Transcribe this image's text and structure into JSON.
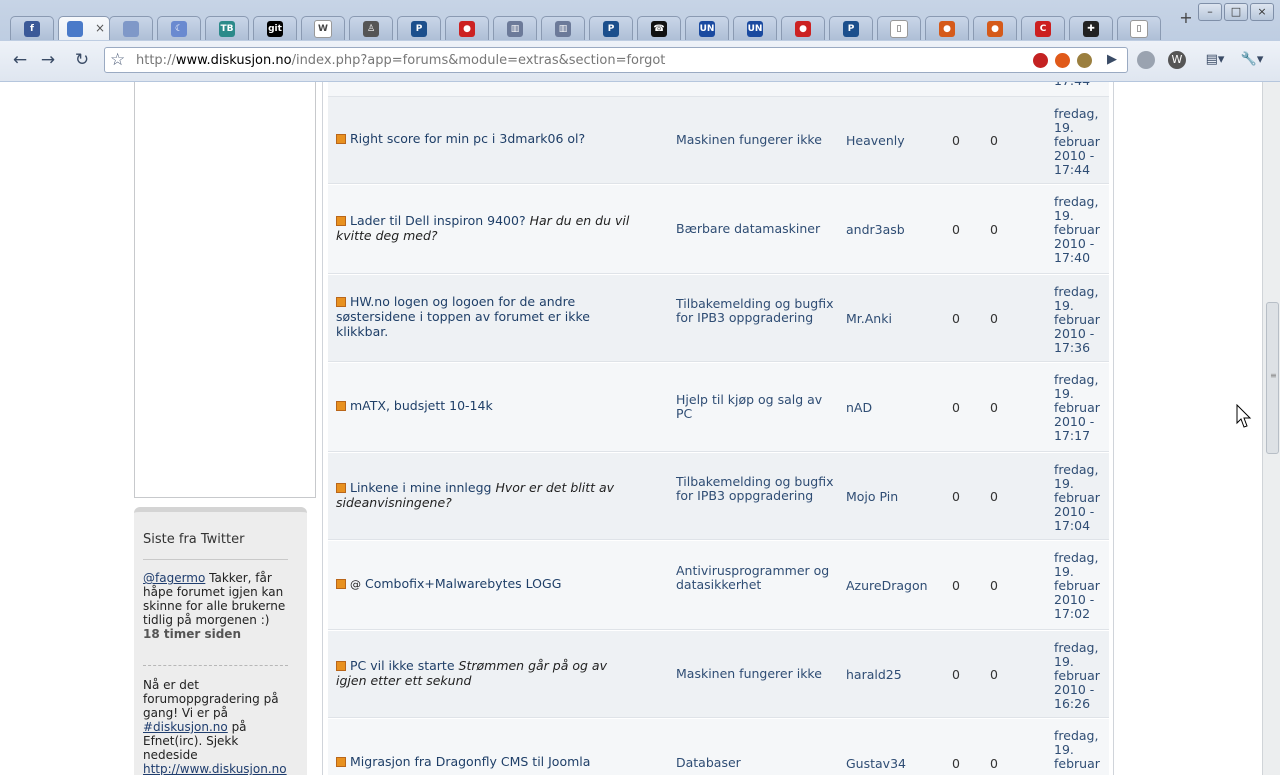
{
  "browser": {
    "tabs": [
      {
        "icon": "f",
        "color": "#3b5998"
      },
      {
        "icon": "",
        "color": "#4a7ac9",
        "active": true
      },
      {
        "icon": "",
        "color": "#7f98c8"
      },
      {
        "icon": "☾",
        "color": "#6a8ad0"
      },
      {
        "icon": "TB",
        "color": "#2c8a8a"
      },
      {
        "icon": "git",
        "color": "#000000"
      },
      {
        "icon": "W",
        "color": "#ffffff"
      },
      {
        "icon": "♙",
        "color": "#555555"
      },
      {
        "icon": "P",
        "color": "#1c4f8c"
      },
      {
        "icon": "●",
        "color": "#cc2222"
      },
      {
        "icon": "▥",
        "color": "#6c7a99"
      },
      {
        "icon": "▥",
        "color": "#6c7a99"
      },
      {
        "icon": "P",
        "color": "#1c4f8c"
      },
      {
        "icon": "☎",
        "color": "#111111"
      },
      {
        "icon": "UN",
        "color": "#1a4aa0"
      },
      {
        "icon": "UN",
        "color": "#1a4aa0"
      },
      {
        "icon": "●",
        "color": "#cc2222"
      },
      {
        "icon": "P",
        "color": "#1c4f8c"
      },
      {
        "icon": "▯",
        "color": "#ffffff"
      },
      {
        "icon": "●",
        "color": "#d55a1a"
      },
      {
        "icon": "●",
        "color": "#d55a1a"
      },
      {
        "icon": "C",
        "color": "#cc1f1f"
      },
      {
        "icon": "✚",
        "color": "#222222"
      },
      {
        "icon": "▯",
        "color": "#ffffff"
      }
    ],
    "tab_close": "×",
    "new_tab": "+",
    "window_controls": {
      "minimize": "–",
      "maximize": "□",
      "close": "×"
    },
    "nav": {
      "back": "←",
      "forward": "→",
      "reload": "↻",
      "star": "☆",
      "go": "▶",
      "page_menu": "▤▾",
      "tools_menu": "🔧▾"
    },
    "url_prefix": "http://",
    "url_host": "www.diskusjon.no",
    "url_path": "/index.php?app=forums&module=extras&section=forgot"
  },
  "sidebar": {
    "twitter_title": "Siste fra Twitter",
    "tweet1_user": "@fagermo",
    "tweet1_text": " Takker, får håpe forumet igjen kan skinne for alle brukerne tidlig på morgenen :)",
    "tweet1_time": "18 timer siden",
    "tweet2_text_a": "Nå er det forumoppgradering på gang! Vi er på ",
    "tweet2_link": "#diskusjon.no",
    "tweet2_text_b": " på Efnet(irc). Sjekk nedeside ",
    "tweet2_url": "http://www.diskusjon.no"
  },
  "table": {
    "partial_top_date": "17:44",
    "rows": [
      {
        "title": "Right score for min pc i 3dmark06 ol?",
        "desc": "",
        "forum": "Maskinen fungerer ikke",
        "author": "Heavenly",
        "replies": "0",
        "views": "0",
        "date": [
          "fredag,",
          "19.",
          "februar",
          "2010 -",
          "17:44"
        ]
      },
      {
        "title": "Lader til Dell inspiron 9400?",
        "desc": "Har du en du vil kvitte deg med?",
        "forum": "Bærbare datamaskiner",
        "author": "andr3asb",
        "replies": "0",
        "views": "0",
        "date": [
          "fredag,",
          "19.",
          "februar",
          "2010 -",
          "17:40"
        ]
      },
      {
        "title": "HW.no logen og logoen for de andre søstersidene i toppen av forumet er ikke klikkbar.",
        "desc": "",
        "forum": "Tilbakemelding og bugfix for IPB3 oppgradering",
        "author": "Mr.Anki",
        "replies": "0",
        "views": "0",
        "date": [
          "fredag,",
          "19.",
          "februar",
          "2010 -",
          "17:36"
        ]
      },
      {
        "title": "mATX, budsjett 10-14k",
        "desc": "",
        "forum": "Hjelp til kjøp og salg av PC",
        "author": "nAD",
        "replies": "0",
        "views": "0",
        "date": [
          "fredag,",
          "19.",
          "februar",
          "2010 -",
          "17:17"
        ]
      },
      {
        "title": "Linkene i mine innlegg",
        "desc": "Hvor er det blitt av sideanvisningene?",
        "forum": "Tilbakemelding og bugfix for IPB3 oppgradering",
        "author": "Mojo Pin",
        "replies": "0",
        "views": "0",
        "date": [
          "fredag,",
          "19.",
          "februar",
          "2010 -",
          "17:04"
        ]
      },
      {
        "title": "Combofix+Malwarebytes LOGG",
        "desc": "",
        "attachment": "@",
        "forum": "Antivirusprogrammer og datasikkerhet",
        "author": "AzureDragon",
        "replies": "0",
        "views": "0",
        "date": [
          "fredag,",
          "19.",
          "februar",
          "2010 -",
          "17:02"
        ]
      },
      {
        "title": "PC vil ikke starte",
        "desc": "Strømmen går på og av igjen etter ett sekund",
        "forum": "Maskinen fungerer ikke",
        "author": "harald25",
        "replies": "0",
        "views": "0",
        "date": [
          "fredag,",
          "19.",
          "februar",
          "2010 -",
          "16:26"
        ]
      },
      {
        "title": "Migrasjon fra Dragonfly CMS til Joomla",
        "desc": "",
        "forum": "Databaser",
        "author": "Gustav34",
        "replies": "0",
        "views": "0",
        "date": [
          "fredag,",
          "19.",
          "februar",
          "",
          ""
        ]
      }
    ]
  }
}
